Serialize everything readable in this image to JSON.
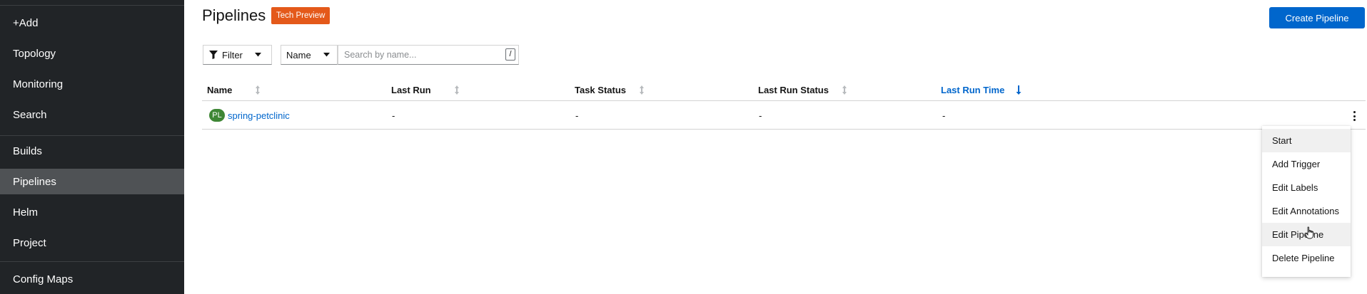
{
  "sidebar": {
    "items": [
      {
        "label": "+Add"
      },
      {
        "label": "Topology"
      },
      {
        "label": "Monitoring"
      },
      {
        "label": "Search"
      },
      {
        "label": "Builds"
      },
      {
        "label": "Pipelines"
      },
      {
        "label": "Helm"
      },
      {
        "label": "Project"
      },
      {
        "label": "Config Maps"
      }
    ],
    "active": "Pipelines"
  },
  "header": {
    "title": "Pipelines",
    "badge": "Tech Preview",
    "create_button": "Create Pipeline"
  },
  "toolbar": {
    "filter_label": "Filter",
    "attribute_select": "Name",
    "search_placeholder": "Search by name...",
    "search_value": "",
    "shortcut_hint": "/"
  },
  "table": {
    "columns": [
      {
        "label": "Name",
        "sorted": false
      },
      {
        "label": "Last Run",
        "sorted": false
      },
      {
        "label": "Task Status",
        "sorted": false
      },
      {
        "label": "Last Run Status",
        "sorted": false
      },
      {
        "label": "Last Run Time",
        "sorted": true,
        "direction": "descending"
      }
    ],
    "rows": [
      {
        "badge": "PL",
        "name": "spring-petclinic",
        "last_run": "-",
        "task_status": "-",
        "last_run_status": "-",
        "last_run_time": "-"
      }
    ]
  },
  "row_menu": {
    "items": [
      {
        "label": "Start"
      },
      {
        "label": "Add Trigger"
      },
      {
        "label": "Edit Labels"
      },
      {
        "label": "Edit Annotations"
      },
      {
        "label": "Edit Pipeline"
      },
      {
        "label": "Delete Pipeline"
      }
    ]
  },
  "colors": {
    "sidebar_bg": "#212427",
    "sidebar_active": "#4f5255",
    "primary": "#0066cc",
    "badge": "#e4591a",
    "pipeline_badge": "#3e8635"
  }
}
